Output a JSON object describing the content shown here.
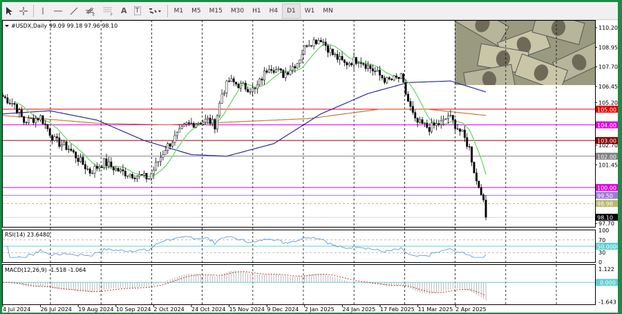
{
  "toolbar": {
    "tools": [
      "cursor-icon",
      "crosshair-icon",
      "vertical-line-icon",
      "horizontal-line-icon",
      "trendline-icon",
      "fibonacci-icon",
      "channel-icon",
      "text-icon",
      "text-label-icon",
      "shapes-icon"
    ],
    "text_tool": "A",
    "text_label_tool": "T",
    "fib_sub": "E",
    "chan_sub": "F",
    "timeframes": [
      "M1",
      "M5",
      "M15",
      "M30",
      "H1",
      "H4",
      "D1",
      "W1",
      "MN"
    ],
    "active_timeframe": "D1"
  },
  "chart_header": {
    "symbol": "#USDX,Daily",
    "ohlc": "99.09 99.18 97.96 98.10"
  },
  "price_axis": [
    "110.20",
    "108.95",
    "107.70",
    "106.45",
    "105.20",
    "102.70",
    "101.45",
    "97.70"
  ],
  "levels": [
    {
      "label": "105.00",
      "value": 105.0,
      "color": "#e00000"
    },
    {
      "label": "104.00",
      "value": 104.0,
      "color": "#e000e0"
    },
    {
      "label": "103.00",
      "value": 103.0,
      "color": "#8b0000"
    },
    {
      "label": "102.00",
      "value": 102.0,
      "color": "#808080"
    },
    {
      "label": "100.00",
      "value": 100.0,
      "color": "#e000e0"
    },
    {
      "label": "99.50",
      "value": 99.5,
      "color": "#9a7fd1"
    },
    {
      "label": "98.98",
      "value": 98.98,
      "color": "#bdb76b",
      "dashed": true
    },
    {
      "label": "98.10",
      "value": 98.1,
      "color": "#000000",
      "current": true
    }
  ],
  "rsi": {
    "title": "RSI(14) 23.6480",
    "axis": [
      "100",
      "70",
      "30",
      "0"
    ],
    "level_label": "50.0000"
  },
  "macd": {
    "title": "MACD(12,26,9) -1.518 -1.064",
    "axis": [
      "1.122",
      "-1.643"
    ],
    "zero_label": "0.000"
  },
  "dates": [
    "4 Jul 2024",
    "26 Jul 2024",
    "19 Aug 2024",
    "10 Sep 2024",
    "2 Oct 2024",
    "24 Oct 2024",
    "15 Nov 2024",
    "9 Dec 2024",
    "2 Jan 2025",
    "24 Jan 2025",
    "17 Feb 2025",
    "11 Mar 2025",
    "2 Apr 2025"
  ],
  "chart_data": {
    "type": "candlestick",
    "bars": 206,
    "close_anchors": [
      [
        0,
        105.8
      ],
      [
        5,
        105.3
      ],
      [
        9,
        104.2
      ],
      [
        16,
        104.5
      ],
      [
        22,
        103.0
      ],
      [
        28,
        102.5
      ],
      [
        37,
        101.0
      ],
      [
        43,
        101.6
      ],
      [
        50,
        101.0
      ],
      [
        62,
        100.6
      ],
      [
        69,
        102.5
      ],
      [
        78,
        104.0
      ],
      [
        87,
        104.3
      ],
      [
        90,
        104.0
      ],
      [
        93,
        106.0
      ],
      [
        96,
        106.8
      ],
      [
        101,
        106.5
      ],
      [
        107,
        106.2
      ],
      [
        113,
        107.8
      ],
      [
        119,
        107.2
      ],
      [
        125,
        108.0
      ],
      [
        129,
        109.2
      ],
      [
        135,
        109.5
      ],
      [
        140,
        108.5
      ],
      [
        145,
        107.9
      ],
      [
        151,
        108.2
      ],
      [
        157,
        107.5
      ],
      [
        163,
        106.8
      ],
      [
        169,
        107.0
      ],
      [
        172,
        105.5
      ],
      [
        175,
        104.2
      ],
      [
        181,
        103.8
      ],
      [
        187,
        104.2
      ],
      [
        189,
        104.6
      ],
      [
        192,
        104.0
      ],
      [
        195,
        103.4
      ],
      [
        198,
        102.5
      ],
      [
        201,
        100.4
      ],
      [
        203,
        99.8
      ],
      [
        205,
        98.1
      ]
    ],
    "ma_slow_blue": [
      [
        0,
        104.7
      ],
      [
        20,
        104.9
      ],
      [
        40,
        104.3
      ],
      [
        60,
        103.0
      ],
      [
        80,
        102.1
      ],
      [
        95,
        102.0
      ],
      [
        115,
        102.8
      ],
      [
        135,
        104.7
      ],
      [
        155,
        106.0
      ],
      [
        172,
        106.7
      ],
      [
        190,
        106.8
      ],
      [
        205,
        106.1
      ]
    ],
    "ma_long_orange": [
      [
        0,
        104.6
      ],
      [
        40,
        104.1
      ],
      [
        70,
        104.0
      ],
      [
        100,
        104.2
      ],
      [
        130,
        104.4
      ],
      [
        160,
        105.0
      ],
      [
        180,
        105.0
      ],
      [
        205,
        104.6
      ]
    ],
    "ylim": [
      97.4,
      110.6
    ]
  },
  "colors": {
    "border": "#1c8a45",
    "ma_fast": "#7ddc7d",
    "ma_blue": "#2a2aa0",
    "ma_orange": "#c87a3a",
    "rsi": "#4a8fd0",
    "level": "#5fd0d0",
    "macd_signal": "#d03030"
  }
}
